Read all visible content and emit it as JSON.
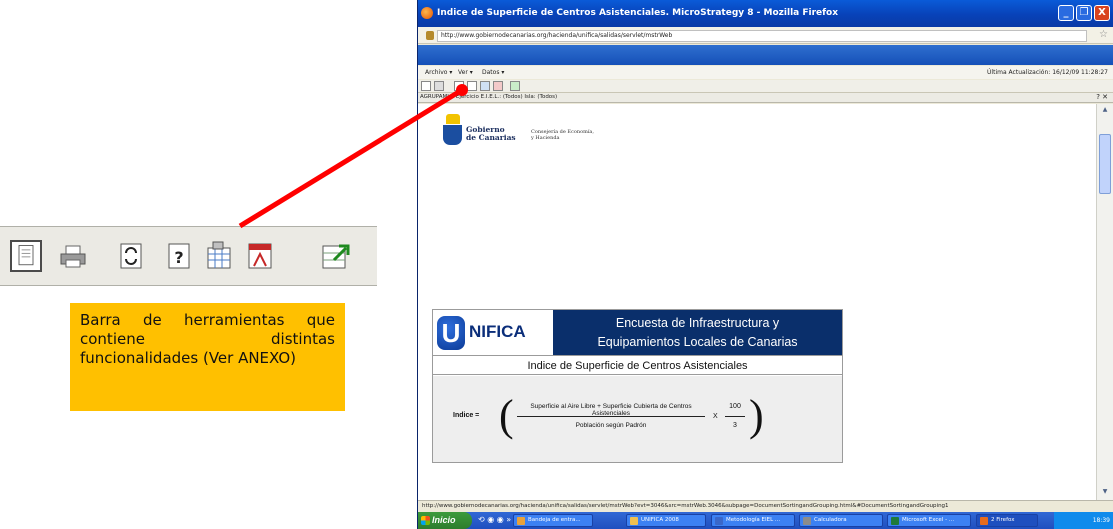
{
  "browser": {
    "title": "Indice de Superficie de Centros Asistenciales. MicroStrategy 8 - Mozilla Firefox",
    "url": "http://www.gobiernodecanarias.org/hacienda/unifica/salidas/servlet/mstrWeb",
    "window_buttons": [
      "_",
      "❐",
      "X"
    ],
    "status_url": "http://www.gobiernodecanarias.org/hacienda/unifica/salidas/servlet/mstrWeb?evt=3046&src=mstrWeb.3046&subpage=DocumentSortingandGrouping.html&#DocumentSortingandGrouping1"
  },
  "menubar": {
    "items": [
      "Archivo ▾",
      "Ver ▾",
      "Datos ▾"
    ],
    "last_update": "Última Actualización: 16/12/09 11:28:27"
  },
  "filterbar": {
    "text": "AGRUPAMI... Ejercicio E.I.E.L.: (Todos) Isla: (Todos)",
    "buttons": "? ✕"
  },
  "logo": {
    "name_line1": "Gobierno",
    "name_line2": "de Canarias",
    "dept_line1": "Consejería de Economía,",
    "dept_line2": "y Hacienda"
  },
  "card": {
    "logo_letter": "U",
    "logo_text": "NIFICA",
    "header_line1": "Encuesta de Infraestructura y",
    "header_line2": "Equipamientos Locales de Canarias",
    "subtitle": "Indice de Superficie de Centros Asistenciales",
    "formula_label": "Indice =",
    "numerator": "Superficie al Aire Libre + Superficie Cubierta de Centros Asistenciales",
    "denominator": "Población según Padrón",
    "times": "X",
    "factor_num": "100",
    "factor_den": "3",
    "paren_open": "(",
    "paren_close": ")"
  },
  "taskbar": {
    "start": "Inicio",
    "quick": "⟲ ◉ ◉ »",
    "tasks": [
      {
        "label": "Bandeja de entra...",
        "color": "#e8a13a"
      },
      {
        "label": "UNIFICA 2008",
        "color": "#f0c050"
      },
      {
        "label": "Metodología EIEL ...",
        "color": "#3a67c9"
      },
      {
        "label": "Calculadora",
        "color": "#8c8c8c"
      },
      {
        "label": "Microsoft Excel - ...",
        "color": "#1f7a3a"
      },
      {
        "label": "2 Firefox",
        "color": "#e66b1d"
      }
    ],
    "clock": "18:39"
  },
  "callout": {
    "text": "Barra de herramientas que contiene distintas funcionalidades (Ver ANEXO)"
  },
  "colors": {
    "arrow": "#ff0000",
    "callout_bg": "#ffc000",
    "card_header": "#0a2f6b"
  }
}
